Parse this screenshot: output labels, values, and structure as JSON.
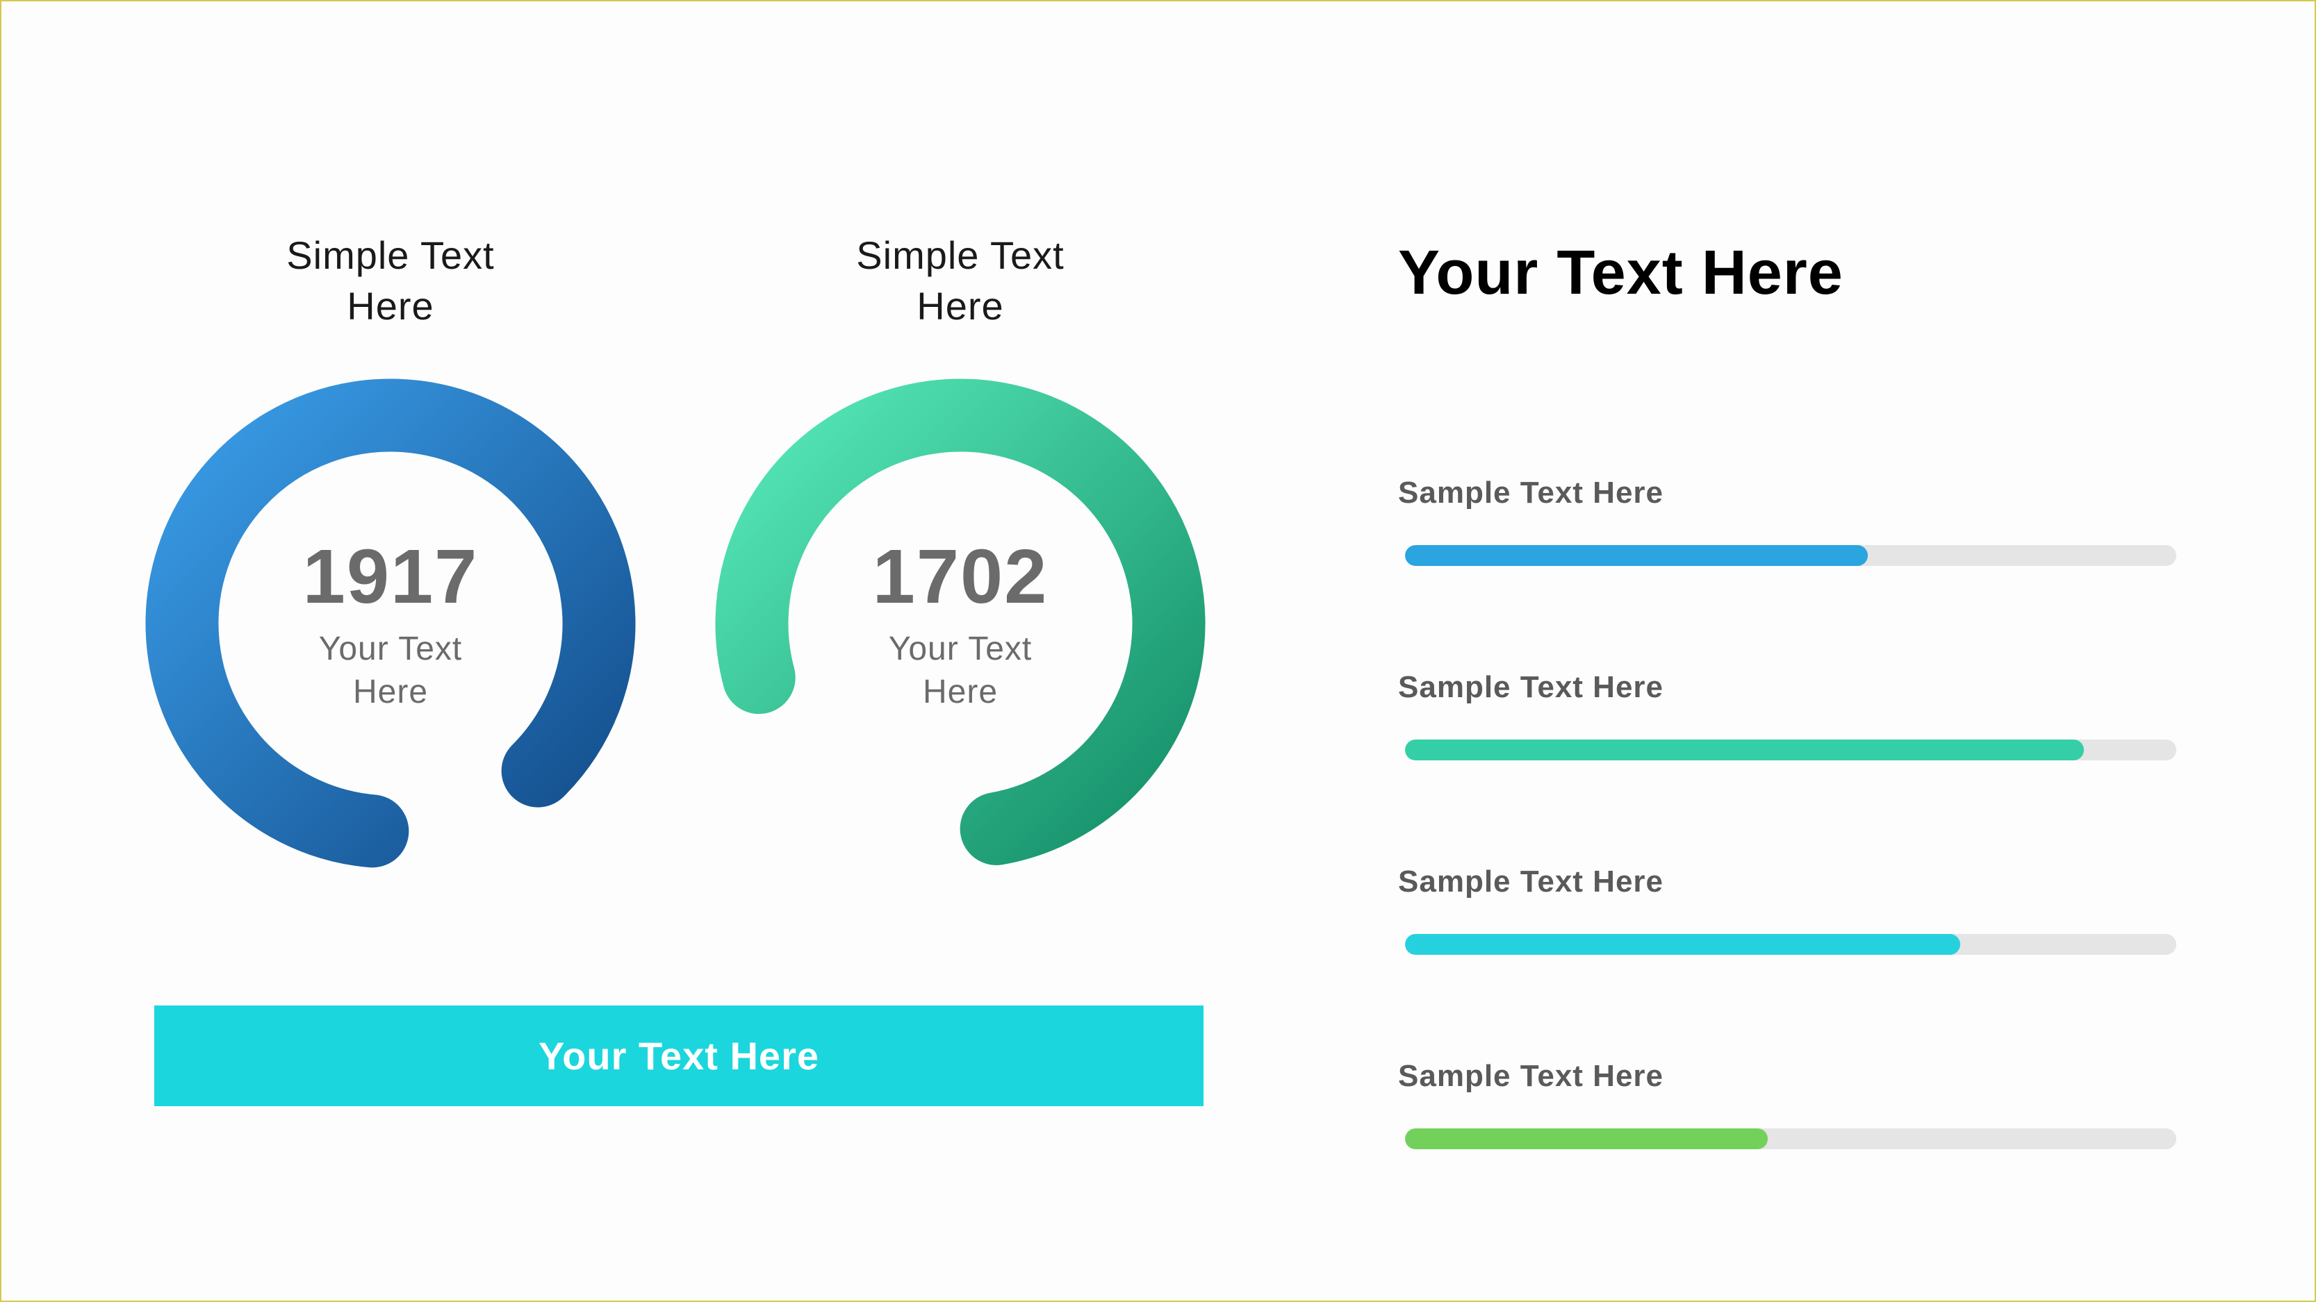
{
  "gauges": [
    {
      "title": "Simple Text\nHere",
      "value": "1917",
      "subtext": "Your Text\nHere",
      "grad_start": "#3a9de8",
      "grad_end": "#134d8b",
      "start_angle": 185,
      "end_angle": 495
    },
    {
      "title": "Simple Text\nHere",
      "value": "1702",
      "subtext": "Your Text\nHere",
      "grad_start": "#56e8b8",
      "grad_end": "#158f69",
      "start_angle": 255,
      "end_angle": 530
    }
  ],
  "banner_text": "Your Text Here",
  "right_title": "Your Text Here",
  "bars": [
    {
      "label": "Sample Text Here",
      "percent": 60,
      "color": "#2aa5e0"
    },
    {
      "label": "Sample Text Here",
      "percent": 88,
      "color": "#34cfa6"
    },
    {
      "label": "Sample Text Here",
      "percent": 72,
      "color": "#26d1de"
    },
    {
      "label": "Sample Text Here",
      "percent": 47,
      "color": "#73d15b"
    }
  ],
  "chart_data": [
    {
      "type": "gauge",
      "title": "Simple Text Here",
      "value": 1917,
      "label": "Your Text Here",
      "arc_fraction": 0.86,
      "color_gradient": [
        "#3a9de8",
        "#134d8b"
      ]
    },
    {
      "type": "gauge",
      "title": "Simple Text Here",
      "value": 1702,
      "label": "Your Text Here",
      "arc_fraction": 0.76,
      "color_gradient": [
        "#56e8b8",
        "#158f69"
      ]
    },
    {
      "type": "bar",
      "orientation": "horizontal",
      "series": [
        {
          "name": "Sample Text Here",
          "value": 60,
          "color": "#2aa5e0"
        },
        {
          "name": "Sample Text Here",
          "value": 88,
          "color": "#34cfa6"
        },
        {
          "name": "Sample Text Here",
          "value": 72,
          "color": "#26d1de"
        },
        {
          "name": "Sample Text Here",
          "value": 47,
          "color": "#73d15b"
        }
      ],
      "xlim": [
        0,
        100
      ]
    }
  ]
}
